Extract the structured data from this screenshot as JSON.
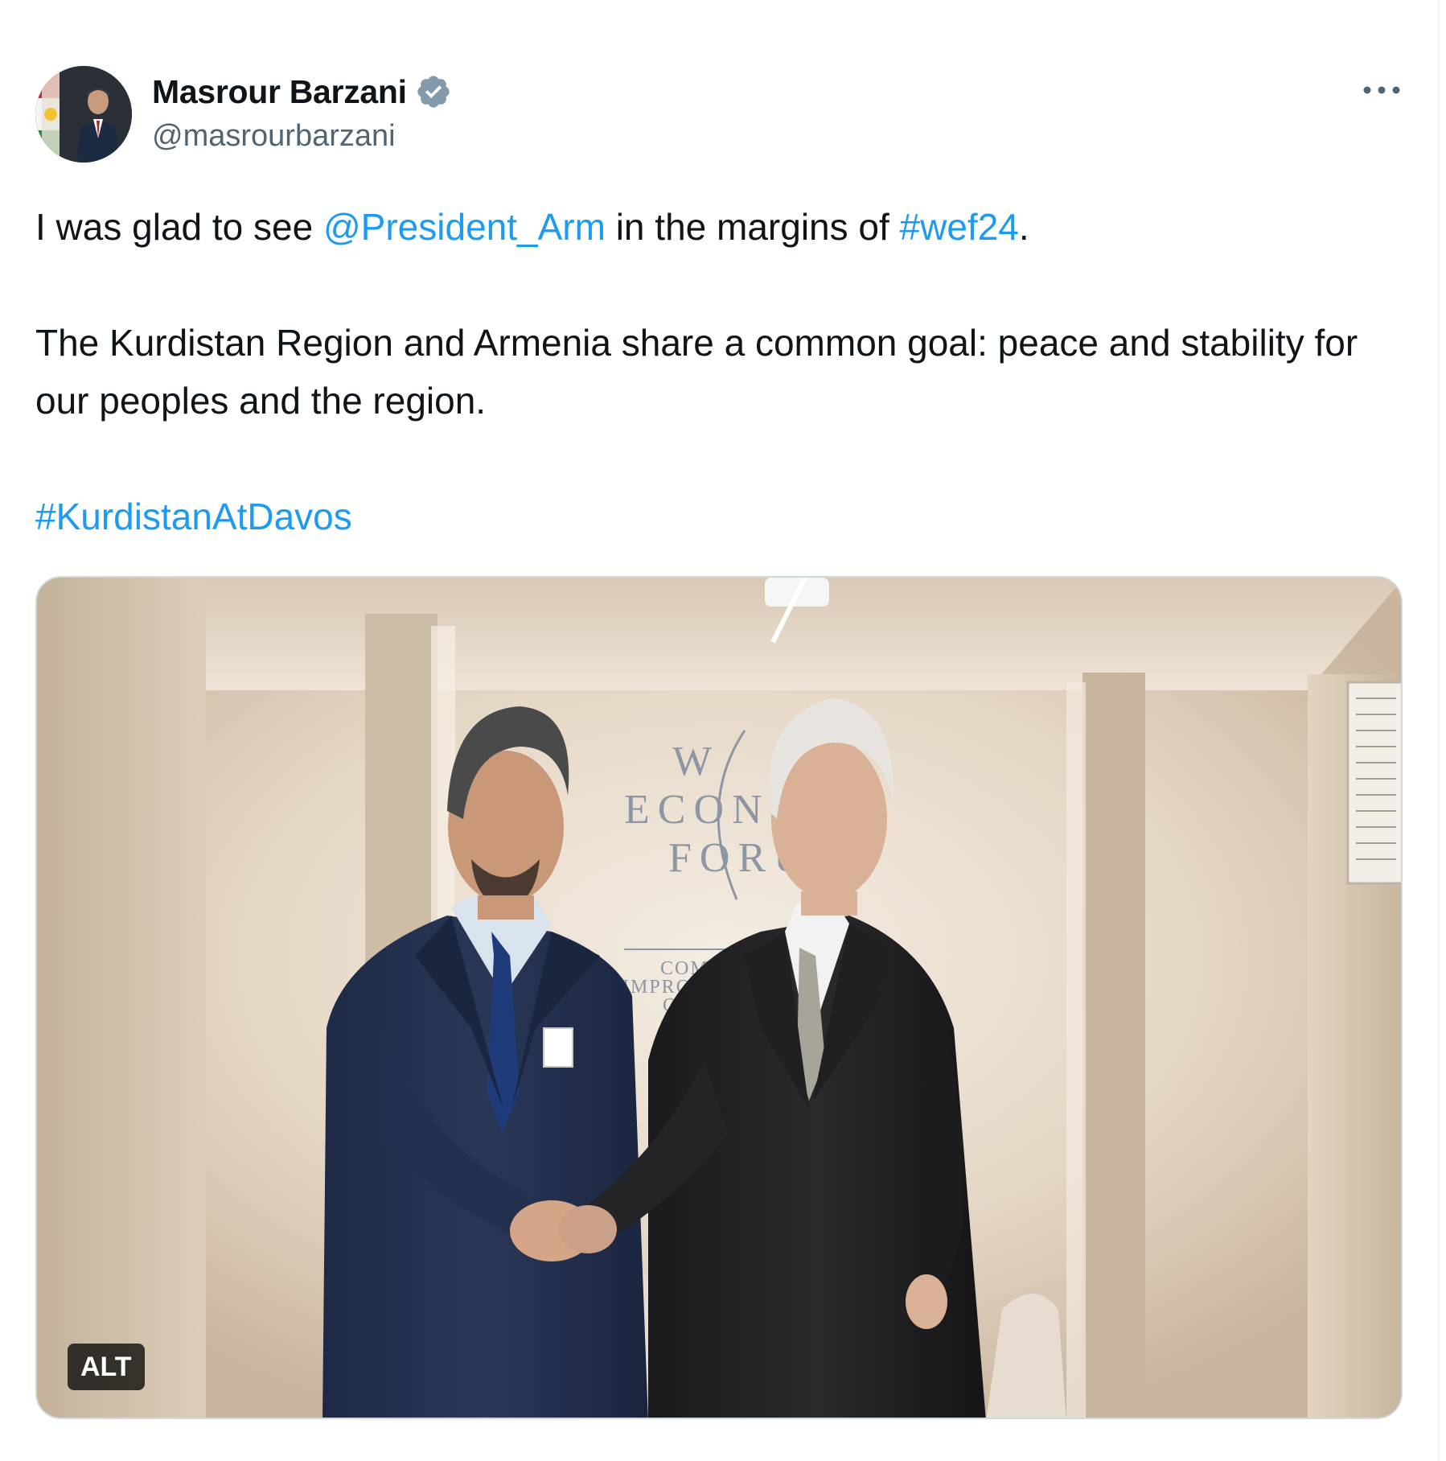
{
  "author": {
    "display_name": "Masrour Barzani",
    "handle": "@masrourbarzani",
    "verified": true,
    "verified_icon": "verified-badge-icon",
    "verified_color": "#829aab"
  },
  "menu": {
    "icon": "more-horizontal-icon"
  },
  "tweet": {
    "line1": {
      "pre": "I was glad to see ",
      "mention": "@President_Arm",
      "mid": " in the margins of ",
      "hashtag": "#wef24",
      "post": "."
    },
    "paragraph2": "The Kurdistan Region and Armenia share a common goal: peace and stability for our peoples and the region.",
    "hashtag2": "#KurdistanAtDavos"
  },
  "media": {
    "backdrop_text": [
      "W",
      "ECONO",
      "FORU"
    ],
    "backdrop_tagline": [
      "COM",
      "IMPROV",
      "OF T"
    ],
    "alt_label": "ALT"
  },
  "colors": {
    "link": "#1d9bf0",
    "text": "#0f1419",
    "secondary": "#536471"
  }
}
